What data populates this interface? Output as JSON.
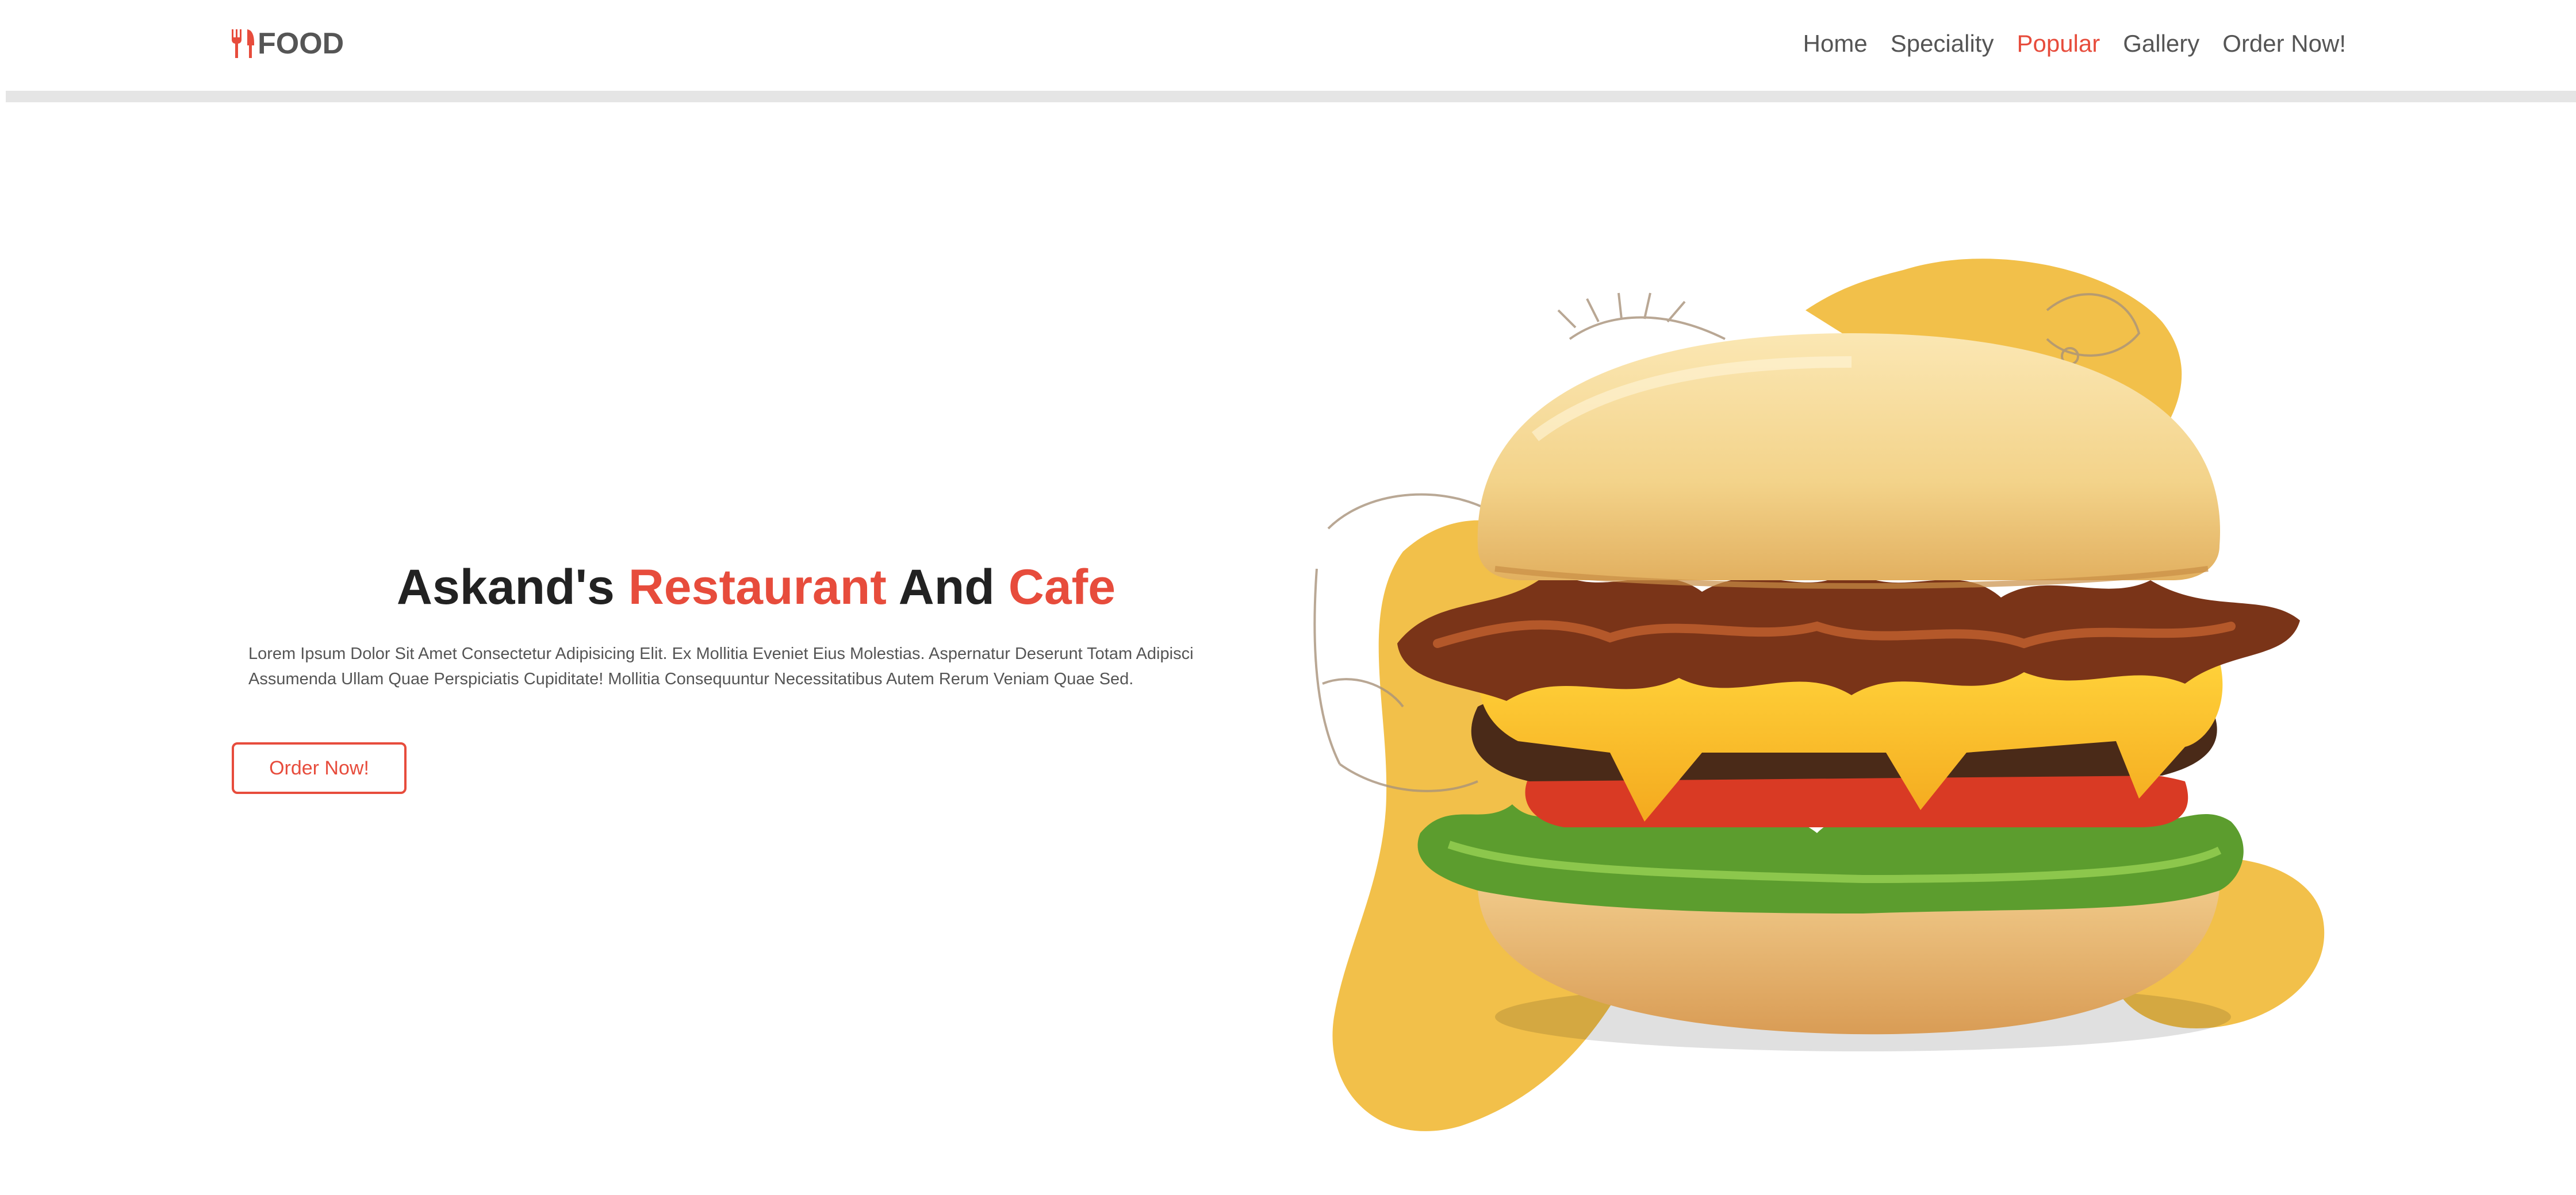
{
  "header": {
    "logo_text": "FOOD",
    "logo_icon": "utensils-icon",
    "nav": [
      {
        "label": "Home",
        "active": false
      },
      {
        "label": "Speciality",
        "active": false
      },
      {
        "label": "Popular",
        "active": true
      },
      {
        "label": "Gallery",
        "active": false
      },
      {
        "label": "Order Now!",
        "active": false
      }
    ]
  },
  "hero": {
    "title_parts": [
      "Askand's",
      "Restaurant",
      "And",
      "Cafe"
    ],
    "description": "Lorem Ipsum Dolor Sit Amet Consectetur Adipisicing Elit. Ex Mollitia Eveniet Eius Molestias. Aspernatur Deserunt Totam Adipisci Assumenda Ullam Quae Perspiciatis Cupiditate! Mollitia Consequuntur Necessitatibus Autem Rerum Veniam Quae Sed.",
    "button_label": "Order Now!",
    "image_icon": "burger-icon"
  },
  "colors": {
    "accent": "#e74c3c",
    "text": "#222222",
    "muted": "#555555",
    "blob": "#f2c04a"
  }
}
